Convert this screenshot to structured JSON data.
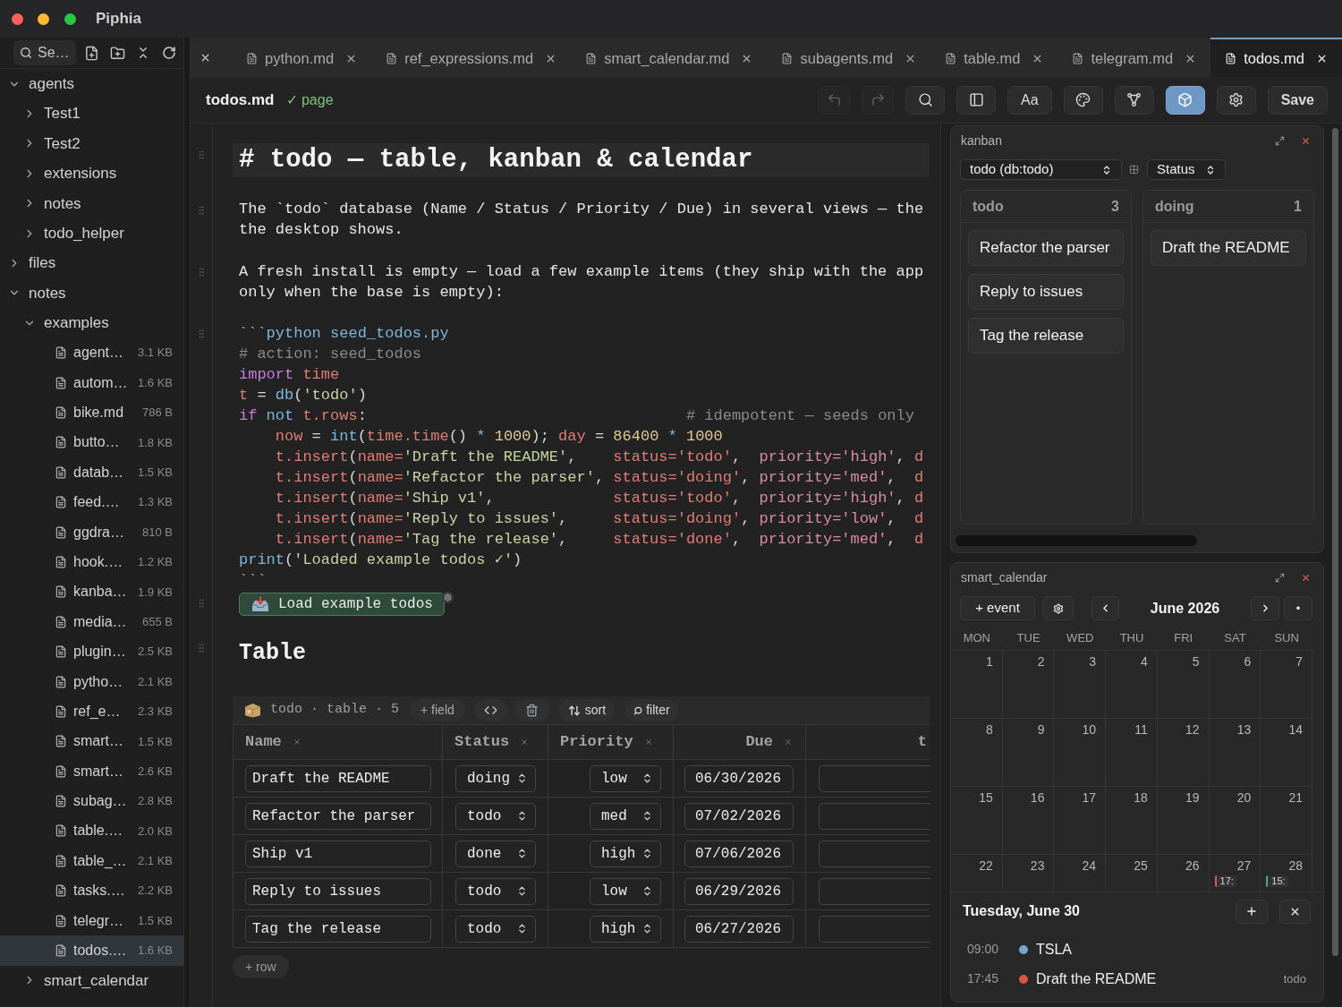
{
  "window": {
    "title": "Piphia"
  },
  "sidebar": {
    "search": {
      "placeholder": "Se…"
    },
    "tree": [
      {
        "kind": "folder",
        "label": "agents",
        "expanded": true,
        "children": [
          {
            "kind": "folder",
            "label": "Test1",
            "expanded": false
          },
          {
            "kind": "folder",
            "label": "Test2",
            "expanded": false
          },
          {
            "kind": "folder",
            "label": "extensions",
            "expanded": false
          },
          {
            "kind": "folder",
            "label": "notes",
            "expanded": false
          },
          {
            "kind": "folder",
            "label": "todo_helper",
            "expanded": false
          }
        ]
      },
      {
        "kind": "folder",
        "label": "files",
        "expanded": false
      },
      {
        "kind": "folder",
        "label": "notes",
        "expanded": true,
        "children": [
          {
            "kind": "folder",
            "label": "examples",
            "expanded": true,
            "children": [
              {
                "kind": "file",
                "label": "agent…",
                "size": "3.1 KB",
                "selected": false
              },
              {
                "kind": "file",
                "label": "autom…",
                "size": "1.6 KB",
                "selected": false
              },
              {
                "kind": "file",
                "label": "bike.md",
                "size": "786 B",
                "selected": false
              },
              {
                "kind": "file",
                "label": "butto…",
                "size": "1.8 KB",
                "selected": false
              },
              {
                "kind": "file",
                "label": "datab…",
                "size": "1.5 KB",
                "selected": false
              },
              {
                "kind": "file",
                "label": "feed.…",
                "size": "1.3 KB",
                "selected": false
              },
              {
                "kind": "file",
                "label": "ggdra…",
                "size": "810 B",
                "selected": false
              },
              {
                "kind": "file",
                "label": "hook.…",
                "size": "1.2 KB",
                "selected": false
              },
              {
                "kind": "file",
                "label": "kanba…",
                "size": "1.9 KB",
                "selected": false
              },
              {
                "kind": "file",
                "label": "media…",
                "size": "655 B",
                "selected": false
              },
              {
                "kind": "file",
                "label": "plugin…",
                "size": "2.5 KB",
                "selected": false
              },
              {
                "kind": "file",
                "label": "pytho…",
                "size": "2.1 KB",
                "selected": false
              },
              {
                "kind": "file",
                "label": "ref_e…",
                "size": "2.3 KB",
                "selected": false
              },
              {
                "kind": "file",
                "label": "smart…",
                "size": "1.5 KB",
                "selected": false
              },
              {
                "kind": "file",
                "label": "smart…",
                "size": "2.6 KB",
                "selected": false
              },
              {
                "kind": "file",
                "label": "subag…",
                "size": "2.8 KB",
                "selected": false
              },
              {
                "kind": "file",
                "label": "table.…",
                "size": "2.0 KB",
                "selected": false
              },
              {
                "kind": "file",
                "label": "table_…",
                "size": "2.1 KB",
                "selected": false
              },
              {
                "kind": "file",
                "label": "tasks.…",
                "size": "2.2 KB",
                "selected": false
              },
              {
                "kind": "file",
                "label": "telegr…",
                "size": "1.5 KB",
                "selected": false
              },
              {
                "kind": "file",
                "label": "todos.…",
                "size": "1.6 KB",
                "selected": true
              }
            ]
          },
          {
            "kind": "folder",
            "label": "smart_calendar",
            "expanded": false
          }
        ]
      }
    ]
  },
  "tab_bar": {
    "scrolled_left": true,
    "tabs": [
      {
        "label": "python.md",
        "selected": false
      },
      {
        "label": "ref_expressions.md",
        "selected": false
      },
      {
        "label": "smart_calendar.md",
        "selected": false
      },
      {
        "label": "subagents.md",
        "selected": false
      },
      {
        "label": "table.md",
        "selected": false
      },
      {
        "label": "telegram.md",
        "selected": false
      },
      {
        "label": "todos.md",
        "selected": true
      }
    ]
  },
  "toolbar": {
    "file_name": "todos.md",
    "status": "✓ page",
    "buttons": [
      {
        "kind": "icon",
        "disabled": true,
        "active": false
      },
      {
        "kind": "icon",
        "disabled": true,
        "active": false
      },
      {
        "kind": "icon",
        "disabled": false,
        "active": false
      },
      {
        "kind": "icon",
        "disabled": false,
        "active": false
      },
      {
        "kind": "text",
        "label": "Aa",
        "disabled": false,
        "active": false
      },
      {
        "kind": "icon",
        "disabled": false,
        "active": false
      },
      {
        "kind": "icon",
        "disabled": false,
        "active": false
      },
      {
        "kind": "icon",
        "disabled": false,
        "active": true
      },
      {
        "kind": "icon",
        "disabled": false,
        "active": false
      },
      {
        "kind": "text",
        "label": "Save",
        "disabled": false,
        "active": false
      }
    ]
  },
  "document": {
    "heading": "# todo — table, kanban & calendar",
    "paragraphs": [
      {
        "lines": [
          "The `todo` database (Name / Status / Priority / Due) in several views — the",
          "the desktop shows."
        ]
      },
      {
        "lines": [
          "A fresh install is empty — load a few example items (they ship with the app",
          "only when the base is empty):"
        ]
      }
    ],
    "code": [
      [
        {
          "text": "```",
          "kind": "fence"
        },
        {
          "text": "python seed_todos.py",
          "kind": "info"
        }
      ],
      [
        {
          "text": "# action: seed_todos",
          "kind": "comment"
        }
      ],
      [
        {
          "text": "import ",
          "kind": "keyword"
        },
        {
          "text": "time",
          "kind": "name"
        }
      ],
      [
        {
          "text": "t",
          "kind": "name"
        },
        {
          "text": " = ",
          "kind": "plain"
        },
        {
          "text": "db",
          "kind": "func"
        },
        {
          "text": "(",
          "kind": "plain"
        },
        {
          "text": "'todo'",
          "kind": "string"
        },
        {
          "text": ")",
          "kind": "plain"
        }
      ],
      [
        {
          "text": "if ",
          "kind": "keyword"
        },
        {
          "text": "not ",
          "kind": "func"
        },
        {
          "text": "t.rows",
          "kind": "name"
        },
        {
          "text": ":                                   ",
          "kind": "plain"
        },
        {
          "text": "# idempotent — seeds only",
          "kind": "comment"
        }
      ],
      [
        {
          "text": "    now",
          "kind": "name"
        },
        {
          "text": " = ",
          "kind": "plain"
        },
        {
          "text": "int",
          "kind": "func"
        },
        {
          "text": "(",
          "kind": "plain"
        },
        {
          "text": "time.time",
          "kind": "name"
        },
        {
          "text": "() ",
          "kind": "plain"
        },
        {
          "text": "* ",
          "kind": "func"
        },
        {
          "text": "1000",
          "kind": "number"
        },
        {
          "text": "); ",
          "kind": "plain"
        },
        {
          "text": "day",
          "kind": "name"
        },
        {
          "text": " = ",
          "kind": "plain"
        },
        {
          "text": "86400 ",
          "kind": "number"
        },
        {
          "text": "* ",
          "kind": "func"
        },
        {
          "text": "1000",
          "kind": "number"
        }
      ],
      [
        {
          "text": "    t.insert",
          "kind": "name"
        },
        {
          "text": "(",
          "kind": "plain"
        },
        {
          "text": "name=",
          "kind": "name"
        },
        {
          "text": "'Draft the README'",
          "kind": "string"
        },
        {
          "text": ",    ",
          "kind": "plain"
        },
        {
          "text": "status='todo'",
          "kind": "name"
        },
        {
          "text": ",  ",
          "kind": "plain"
        },
        {
          "text": "priority='high'",
          "kind": "attr"
        },
        {
          "text": ", ",
          "kind": "plain"
        },
        {
          "text": "d",
          "kind": "name"
        }
      ],
      [
        {
          "text": "    t.insert",
          "kind": "name"
        },
        {
          "text": "(",
          "kind": "plain"
        },
        {
          "text": "name=",
          "kind": "name"
        },
        {
          "text": "'Refactor the parser'",
          "kind": "string"
        },
        {
          "text": ", ",
          "kind": "plain"
        },
        {
          "text": "status='doing'",
          "kind": "name"
        },
        {
          "text": ", ",
          "kind": "plain"
        },
        {
          "text": "priority='med'",
          "kind": "attr"
        },
        {
          "text": ",  ",
          "kind": "plain"
        },
        {
          "text": "d",
          "kind": "name"
        }
      ],
      [
        {
          "text": "    t.insert",
          "kind": "name"
        },
        {
          "text": "(",
          "kind": "plain"
        },
        {
          "text": "name=",
          "kind": "name"
        },
        {
          "text": "'Ship v1'",
          "kind": "string"
        },
        {
          "text": ",             ",
          "kind": "plain"
        },
        {
          "text": "status='todo'",
          "kind": "name"
        },
        {
          "text": ",  ",
          "kind": "plain"
        },
        {
          "text": "priority='high'",
          "kind": "attr"
        },
        {
          "text": ", ",
          "kind": "plain"
        },
        {
          "text": "d",
          "kind": "name"
        }
      ],
      [
        {
          "text": "    t.insert",
          "kind": "name"
        },
        {
          "text": "(",
          "kind": "plain"
        },
        {
          "text": "name=",
          "kind": "name"
        },
        {
          "text": "'Reply to issues'",
          "kind": "string"
        },
        {
          "text": ",     ",
          "kind": "plain"
        },
        {
          "text": "status='doing'",
          "kind": "name"
        },
        {
          "text": ", ",
          "kind": "plain"
        },
        {
          "text": "priority='low'",
          "kind": "attr"
        },
        {
          "text": ",  ",
          "kind": "plain"
        },
        {
          "text": "d",
          "kind": "name"
        }
      ],
      [
        {
          "text": "    t.insert",
          "kind": "name"
        },
        {
          "text": "(",
          "kind": "plain"
        },
        {
          "text": "name=",
          "kind": "name"
        },
        {
          "text": "'Tag the release'",
          "kind": "string"
        },
        {
          "text": ",     ",
          "kind": "plain"
        },
        {
          "text": "status='done'",
          "kind": "name"
        },
        {
          "text": ",  ",
          "kind": "plain"
        },
        {
          "text": "priority='med'",
          "kind": "attr"
        },
        {
          "text": ",  ",
          "kind": "plain"
        },
        {
          "text": "d",
          "kind": "name"
        }
      ],
      [
        {
          "text": "print",
          "kind": "func"
        },
        {
          "text": "(",
          "kind": "plain"
        },
        {
          "text": "'Loaded example todos ✓'",
          "kind": "string"
        },
        {
          "text": ")",
          "kind": "plain"
        }
      ],
      [
        {
          "text": "```",
          "kind": "fence"
        }
      ]
    ],
    "action": {
      "label": "Load example todos"
    },
    "section_heading": "Table",
    "table": {
      "title": "todo · table · 5",
      "add_field": "+ field",
      "sort": "sort",
      "filter": "filter",
      "columns": [
        {
          "label": "Name",
          "kind": "text"
        },
        {
          "label": "Status",
          "kind": "select"
        },
        {
          "label": "Priority",
          "kind": "rank"
        },
        {
          "label": "Due",
          "kind": "date"
        },
        {
          "label": "t",
          "kind": "blank"
        }
      ],
      "rows": [
        {
          "cells": [
            "Draft the README",
            "doing",
            "low",
            "06/30/2026"
          ]
        },
        {
          "cells": [
            "Refactor the parser",
            "todo",
            "med",
            "07/02/2026"
          ]
        },
        {
          "cells": [
            "Ship v1",
            "done",
            "high",
            "07/06/2026"
          ]
        },
        {
          "cells": [
            "Reply to issues",
            "todo",
            "low",
            "06/29/2026"
          ]
        },
        {
          "cells": [
            "Tag the release",
            "todo",
            "high",
            "06/27/2026"
          ]
        }
      ],
      "add_row": "+ row"
    }
  },
  "kanban": {
    "title": "kanban",
    "source": "todo (db:todo)",
    "group_by": "Status",
    "columns": [
      {
        "label": "todo",
        "count": "3",
        "cards": [
          "Refactor the parser",
          "Reply to issues",
          "Tag the release"
        ]
      },
      {
        "label": "doing",
        "count": "1",
        "cards": [
          "Draft the README"
        ]
      }
    ]
  },
  "calendar": {
    "title": "smart_calendar",
    "add_event": "+ event",
    "month": "June 2026",
    "today": "•",
    "weekdays": [
      "MON",
      "TUE",
      "WED",
      "THU",
      "FRI",
      "SAT",
      "SUN"
    ],
    "weeks": [
      [
        {
          "day": "1"
        },
        {
          "day": "2"
        },
        {
          "day": "3"
        },
        {
          "day": "4"
        },
        {
          "day": "5"
        },
        {
          "day": "6"
        },
        {
          "day": "7"
        }
      ],
      [
        {
          "day": "8"
        },
        {
          "day": "9"
        },
        {
          "day": "10"
        },
        {
          "day": "11"
        },
        {
          "day": "12"
        },
        {
          "day": "13"
        },
        {
          "day": "14"
        }
      ],
      [
        {
          "day": "15"
        },
        {
          "day": "16"
        },
        {
          "day": "17"
        },
        {
          "day": "18"
        },
        {
          "day": "19"
        },
        {
          "day": "20"
        },
        {
          "day": "21"
        }
      ],
      [
        {
          "day": "22"
        },
        {
          "day": "23"
        },
        {
          "day": "24"
        },
        {
          "day": "25"
        },
        {
          "day": "26"
        },
        {
          "day": "27",
          "events": [
            {
              "label": "17:",
              "color": "#cf5b4c"
            }
          ]
        },
        {
          "day": "28",
          "events": [
            {
              "label": "15:",
              "color": "#4fa58a"
            }
          ]
        }
      ]
    ],
    "agenda": {
      "date": "Tuesday, June 30",
      "items": [
        {
          "time": "09:00",
          "label": "TSLA",
          "color": "#79a3cf"
        },
        {
          "time": "17:45",
          "label": "Draft the README",
          "color": "#d5553f",
          "tag": "todo"
        }
      ]
    }
  }
}
